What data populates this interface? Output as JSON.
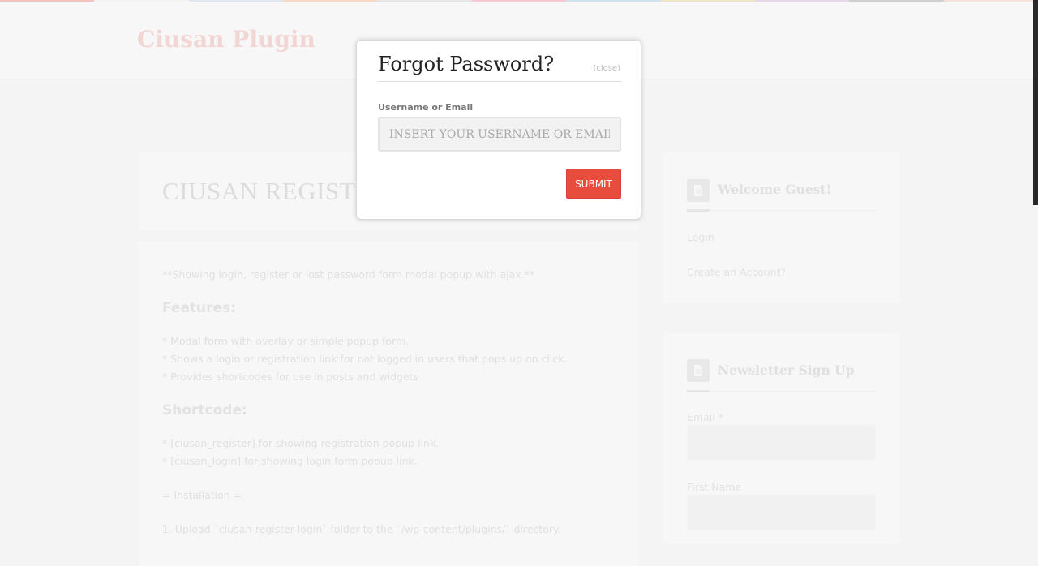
{
  "header": {
    "site_title": "Ciusan Plugin"
  },
  "page": {
    "heading": "CIUSAN REGISTE",
    "intro": "**Showing login, register or lost password form modal popup with ajax.**",
    "features_heading": "Features:",
    "features": [
      "* Modal form with overlay or simple popup form.",
      "* Shows a login or registration link for not logged in users that pops up on click.",
      "* Provides shortcodes for use in posts and widgets"
    ],
    "shortcode_heading": "Shortcode:",
    "shortcodes": [
      "* [ciusan_register] for showing registration popup link.",
      "* [ciusan_login] for showing login form popup link."
    ],
    "installation_heading": "= Installation =",
    "installation_step_1": "1. Upload `ciusan-register-login` folder to the `/wp-content/plugins/` directory."
  },
  "sidebar": {
    "welcome": {
      "title": "Welcome Guest!",
      "login_link": "Login",
      "register_link": "Create an Account?"
    },
    "newsletter": {
      "title": "Newsletter Sign Up",
      "email_label": "Email *",
      "first_name_label": "First Name"
    }
  },
  "modal": {
    "title": "Forgot Password?",
    "close_label": "(close)",
    "field_label": "Username or Email",
    "field_placeholder": "INSERT YOUR USERNAME OR EMAIL",
    "field_value": "",
    "submit_label": "SUBMIT"
  },
  "colors": {
    "accent": "#e74c3c",
    "site_title": "#f2d6d4",
    "top_bar": [
      "#f4c3c0",
      "#f2f2f2",
      "#dfe7f0",
      "#f5d9c4",
      "#e6e6e6",
      "#f6c9cf",
      "#cfe3ef",
      "#f1e5c8",
      "#e8d7ea",
      "#d0d0d0",
      "#f7e2dc"
    ]
  },
  "icons": {
    "widget_icon": "document-icon"
  }
}
